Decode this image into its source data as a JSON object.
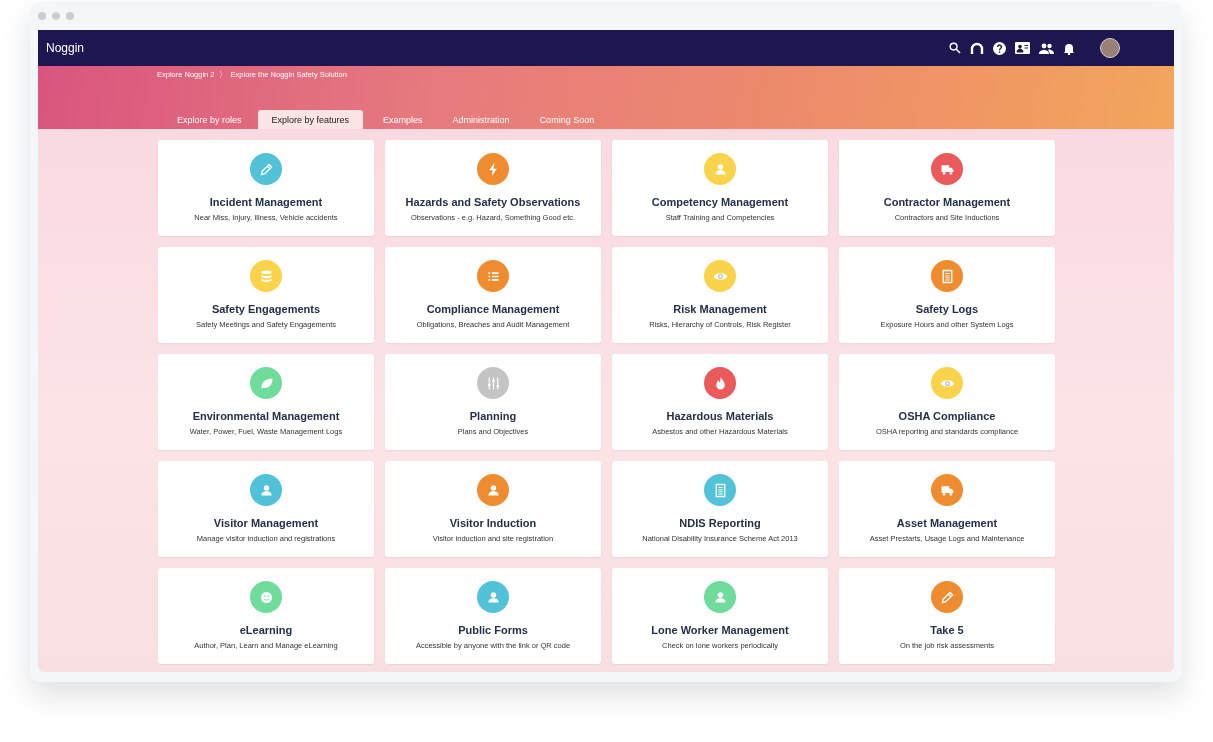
{
  "window": {
    "title": "Noggin"
  },
  "breadcrumb": [
    {
      "label": "Explore Noggin 2"
    },
    {
      "label": "Explore the Noggin Safety Solution"
    }
  ],
  "breadcrumb_separator": "〉",
  "tabs": [
    {
      "label": "Explore by roles",
      "selected": false
    },
    {
      "label": "Explore by features",
      "selected": true
    },
    {
      "label": "Examples",
      "selected": false
    },
    {
      "label": "Administration",
      "selected": false
    },
    {
      "label": "Coming Soon",
      "selected": false
    }
  ],
  "cards": [
    {
      "title": "Incident Management",
      "subtitle": "Near Miss, Injury, Illness, Vehicle accidents",
      "kind": "pencil",
      "color": "#52c2d8"
    },
    {
      "title": "Hazards and Safety Observations",
      "subtitle": "Observations - e.g. Hazard, Something Good etc.",
      "kind": "bolt",
      "color": "#f08c30"
    },
    {
      "title": "Competency Management",
      "subtitle": "Staff Training and Competencies",
      "kind": "person",
      "color": "#f9d44a"
    },
    {
      "title": "Contractor Management",
      "subtitle": "Contractors and Site Inductions",
      "kind": "truck",
      "color": "#ea5a5a"
    },
    {
      "title": "Safety Engagements",
      "subtitle": "Safety Meetings and Safety Engagements",
      "kind": "database",
      "color": "#f9d44a"
    },
    {
      "title": "Compliance Management",
      "subtitle": "Obligations, Breaches and Audit Management",
      "kind": "list",
      "color": "#f08c30"
    },
    {
      "title": "Risk Management",
      "subtitle": "Risks, Hierarchy of Controls, Risk Register",
      "kind": "eye",
      "color": "#f9d44a"
    },
    {
      "title": "Safety Logs",
      "subtitle": "Exposure Hours and other System Logs",
      "kind": "document",
      "color": "#f08c30"
    },
    {
      "title": "Environmental Management",
      "subtitle": "Water, Power, Fuel, Waste Management Logs",
      "kind": "leaf",
      "color": "#6fdc9c"
    },
    {
      "title": "Planning",
      "subtitle": "Plans and Objectives",
      "kind": "sliders",
      "color": "#c4c4c4"
    },
    {
      "title": "Hazardous Materials",
      "subtitle": "Asbestos and other Hazardous Materials",
      "kind": "flame",
      "color": "#ea5a5a"
    },
    {
      "title": "OSHA Compliance",
      "subtitle": "OSHA reporting and standards compliance",
      "kind": "eye",
      "color": "#f9d44a"
    },
    {
      "title": "Visitor Management",
      "subtitle": "Manage visitor induction and registrations",
      "kind": "person",
      "color": "#52c2d8"
    },
    {
      "title": "Visitor Induction",
      "subtitle": "Visitor induction and site registration",
      "kind": "person",
      "color": "#f08c30"
    },
    {
      "title": "NDIS Reporting",
      "subtitle": "National Disability Insurance Scheme Act 2013",
      "kind": "document",
      "color": "#52c2d8"
    },
    {
      "title": "Asset Management",
      "subtitle": "Asset Prestarts, Usage Logs and Maintenance",
      "kind": "truck",
      "color": "#f08c30"
    },
    {
      "title": "eLearning",
      "subtitle": "Author, Plan, Learn and Manage eLearning",
      "kind": "smiley",
      "color": "#6fdc9c"
    },
    {
      "title": "Public Forms",
      "subtitle": "Accessible by anyone with the link or QR code",
      "kind": "person",
      "color": "#52c2d8"
    },
    {
      "title": "Lone Worker Management",
      "subtitle": "Check on lone workers periodically",
      "kind": "person",
      "color": "#6fdc9c"
    },
    {
      "title": "Take 5",
      "subtitle": "On the job risk assessments",
      "kind": "pencil",
      "color": "#f08c30"
    }
  ]
}
